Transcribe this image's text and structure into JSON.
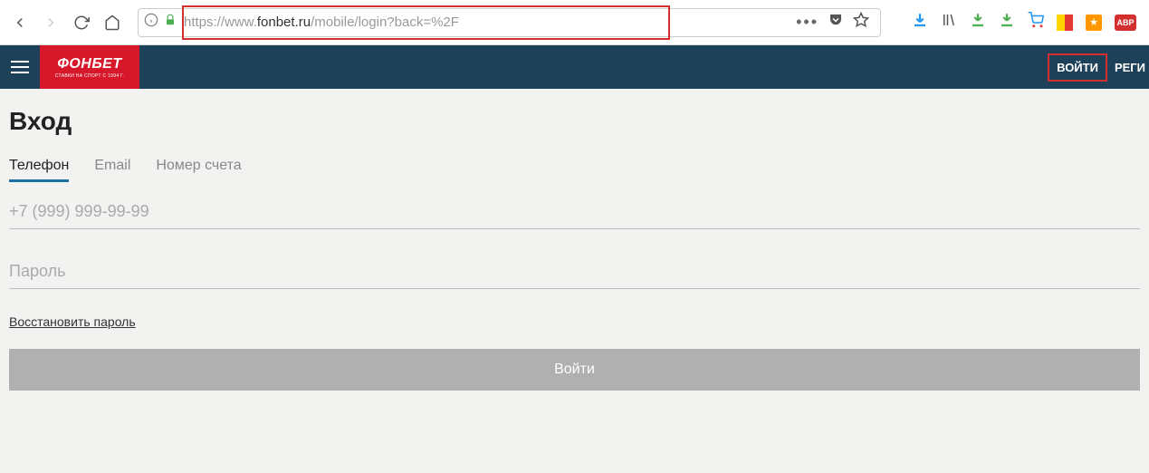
{
  "browser": {
    "url_prefix": "https://www.",
    "url_domain": "fonbet.ru",
    "url_suffix": "/mobile/login?back=%2F",
    "dots": "•••",
    "abp_label": "ABP"
  },
  "header": {
    "logo_text": "ФОНБЕТ",
    "logo_sub": "СТАВКИ НА СПОРТ С 1994 Г.",
    "login_label": "ВОЙТИ",
    "register_label": "РЕГИ"
  },
  "page": {
    "title": "Вход",
    "tabs": {
      "phone": "Телефон",
      "email": "Email",
      "account": "Номер счета"
    },
    "phone_placeholder": "+7 (999) 999-99-99",
    "password_placeholder": "Пароль",
    "recover_label": "Восстановить пароль",
    "submit_label": "Войти"
  }
}
